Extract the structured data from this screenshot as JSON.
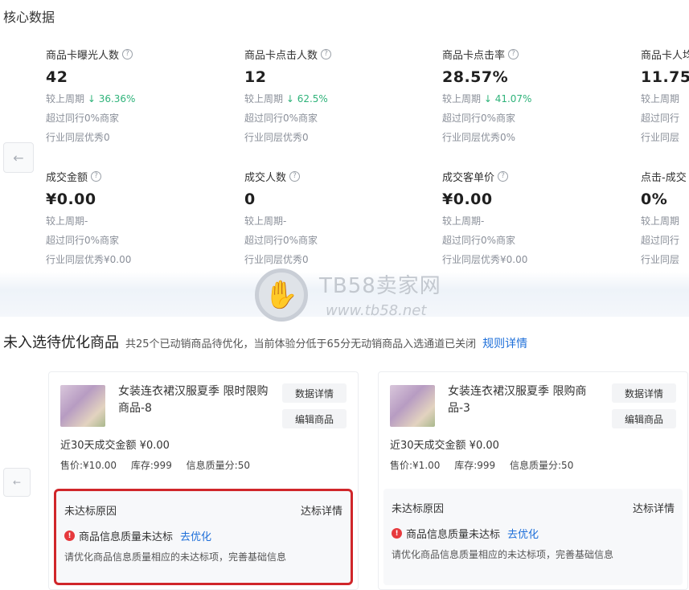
{
  "core": {
    "title": "核心数据",
    "prev_icon": "←",
    "metrics": [
      {
        "label": "商品卡曝光人数",
        "value": "42",
        "line1": "较上周期 ↓ 36.36%",
        "line2": "超过同行0%商家",
        "line3": "行业同层优秀0"
      },
      {
        "label": "商品卡点击人数",
        "value": "12",
        "line1": "较上周期 ↓ 62.5%",
        "line2": "超过同行0%商家",
        "line3": "行业同层优秀0"
      },
      {
        "label": "商品卡点击率",
        "value": "28.57%",
        "line1": "较上周期 ↓ 41.07%",
        "line2": "超过同行0%商家",
        "line3": "行业同层优秀0%"
      },
      {
        "label": "商品卡人均",
        "value": "11.75",
        "line1": "较上周期",
        "line2": "超过同行",
        "line3": "行业同层"
      },
      {
        "label": "成交金额",
        "value": "¥0.00",
        "line1": "较上周期-",
        "line2": "超过同行0%商家",
        "line3": "行业同层优秀¥0.00"
      },
      {
        "label": "成交人数",
        "value": "0",
        "line1": "较上周期-",
        "line2": "超过同行0%商家",
        "line3": "行业同层优秀0"
      },
      {
        "label": "成交客单价",
        "value": "¥0.00",
        "line1": "较上周期-",
        "line2": "超过同行0%商家",
        "line3": "行业同层优秀¥0.00"
      },
      {
        "label": "点击-成交",
        "value": "0%",
        "line1": "较上周期",
        "line2": "超过同行",
        "line3": "行业同层"
      }
    ]
  },
  "watermark": {
    "title": "TB58卖家网",
    "url": "www.tb58.net"
  },
  "optimize": {
    "title": "未入选待优化商品",
    "description": "共25个已动销商品待优化，当前体验分低于65分无动销商品入选通道已关闭",
    "rules_link": "规则详情",
    "prev_icon": "←",
    "cards": [
      {
        "title": "女装连衣裙汉服夏季 限时限购商品-8",
        "detail_button": "数据详情",
        "edit_button": "编辑商品",
        "sales": "近30天成交金额 ¥0.00",
        "price": "售价:¥10.00",
        "stock": "库存:999",
        "quality": "信息质量分:50",
        "reason_head": "未达标原因",
        "reason_link": "达标详情",
        "issue": "商品信息质量未达标",
        "fix_link": "去优化",
        "issue_desc": "请优化商品信息质量相应的未达标项，完善基础信息"
      },
      {
        "title": "女装连衣裙汉服夏季 限购商品-3",
        "detail_button": "数据详情",
        "edit_button": "编辑商品",
        "sales": "近30天成交金额 ¥0.00",
        "price": "售价:¥1.00",
        "stock": "库存:999",
        "quality": "信息质量分:50",
        "reason_head": "未达标原因",
        "reason_link": "达标详情",
        "issue": "商品信息质量未达标",
        "fix_link": "去优化",
        "issue_desc": "请优化商品信息质量相应的未达标项，完善基础信息"
      }
    ]
  }
}
